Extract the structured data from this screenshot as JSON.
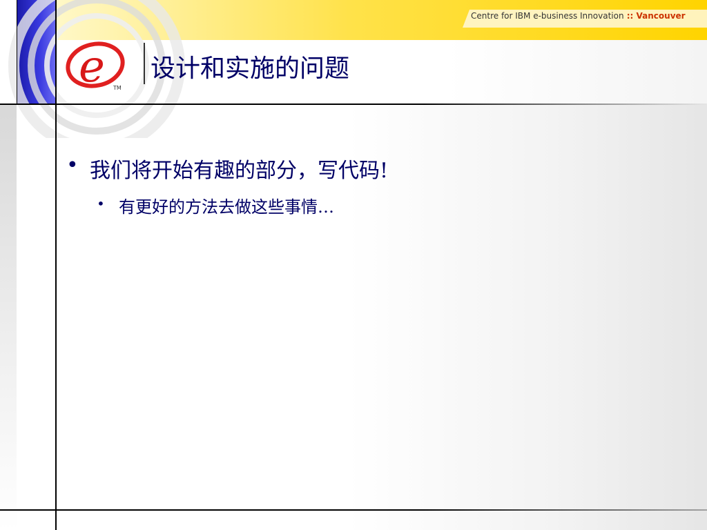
{
  "header": {
    "caption_main": "Centre for IBM e-business Innovation",
    "caption_sep": " :: ",
    "caption_accent": "Vancouver"
  },
  "logo": {
    "letter": "e",
    "trademark": "TM",
    "icon": "ibm-e-logo-icon"
  },
  "slide": {
    "title": "设计和实施的问题",
    "bullet_glyph": "•",
    "bullets": [
      {
        "text": "我们将开始有趣的部分，写代码!",
        "sub": [
          "有更好的方法去做这些事情…"
        ]
      }
    ]
  },
  "colors": {
    "title": "#000066",
    "banner_yellow": "#ffd400",
    "strip_blue": "#2a2ad0",
    "logo_red": "#e02020"
  }
}
